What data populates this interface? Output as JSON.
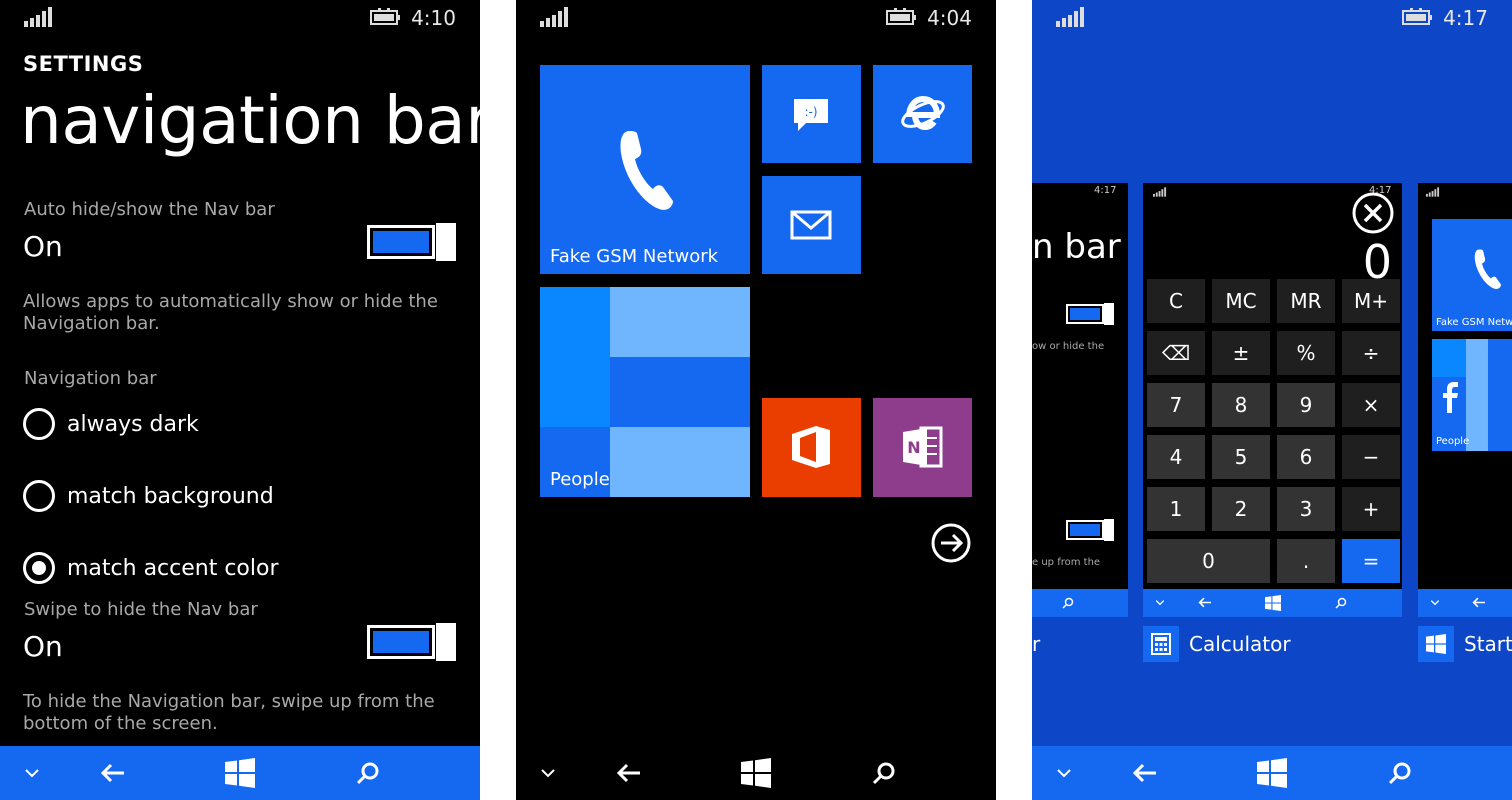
{
  "colors": {
    "accent": "#1469f0",
    "switcher_bg": "#0d47c7",
    "office": "#ea3e00",
    "onenote": "#8e3c8c",
    "people_light": "#6fb6ff",
    "people_mid": "#0a86ff"
  },
  "screen1": {
    "time": "4:10",
    "app_title": "SETTINGS",
    "page_title": "navigation bar",
    "auto_hide": {
      "label": "Auto hide/show the Nav bar",
      "value": "On",
      "description": "Allows apps to automatically show or hide the Navigation bar."
    },
    "nav_bar_group_label": "Navigation bar",
    "options": [
      {
        "label": "always dark",
        "selected": false
      },
      {
        "label": "match background",
        "selected": false
      },
      {
        "label": "match accent color",
        "selected": true
      }
    ],
    "swipe_hide": {
      "label": "Swipe to hide the Nav bar",
      "value": "On",
      "description": "To hide the Navigation bar, swipe up from the bottom of the screen."
    }
  },
  "screen2": {
    "time": "4:04",
    "tiles": {
      "phone_label": "Fake GSM Network",
      "people_label": "People"
    }
  },
  "screen3": {
    "time": "4:17",
    "left_card": {
      "time": "4:17",
      "title_fragment": "n bar",
      "desc_fragment_1": "ow or hide the",
      "desc_fragment_2": "e up from the",
      "caption_fragment": "r"
    },
    "calc_card": {
      "display": "0",
      "keys": [
        [
          "C",
          "MC",
          "MR",
          "M+"
        ],
        [
          "⌫",
          "±",
          "%",
          "÷"
        ],
        [
          "7",
          "8",
          "9",
          "×"
        ],
        [
          "4",
          "5",
          "6",
          "−"
        ],
        [
          "1",
          "2",
          "3",
          "+"
        ],
        [
          "0",
          ".",
          "="
        ]
      ],
      "caption": "Calculator",
      "time": "4:17"
    },
    "start_card": {
      "tile_label": "Fake GSM Netw",
      "people_label": "People",
      "caption": "Start"
    }
  }
}
